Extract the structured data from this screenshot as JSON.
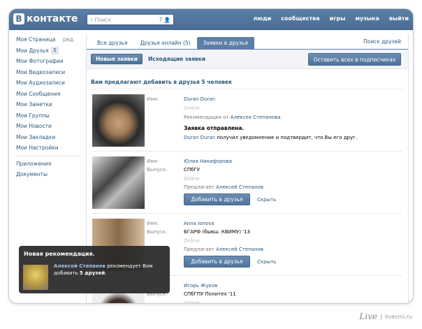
{
  "header": {
    "logo": "В",
    "logo_text": "контакте",
    "search_placeholder": "Поиск",
    "search_count": "7",
    "nav": [
      "люди",
      "сообщества",
      "игры",
      "музыка",
      "выйти"
    ]
  },
  "sidebar": {
    "items": [
      {
        "label": "Моя Страница",
        "extra": "ред."
      },
      {
        "label": "Мои Друзья",
        "badge": "5"
      },
      {
        "label": "Мои Фотографии"
      },
      {
        "label": "Мои Видеозаписи"
      },
      {
        "label": "Мои Аудиозаписи"
      },
      {
        "label": "Мои Сообщения"
      },
      {
        "label": "Мои Заметки"
      },
      {
        "label": "Мои Группы"
      },
      {
        "label": "Мои Новости"
      },
      {
        "label": "Мои Закладки"
      },
      {
        "label": "Мои Настройки"
      }
    ],
    "extra": [
      "Приложения",
      "Документы"
    ]
  },
  "tabs": [
    "Все друзья",
    "Друзья онлайн (5)",
    "Заявки в друзья"
  ],
  "find_friends": "Поиск друзей",
  "subtabs": {
    "new": "Новые заявки",
    "outgoing": "Исходящие заявки",
    "leave_all": "Оставить всех в подписчиках"
  },
  "title": "Вам предлагают добавить в друзья 5 человек",
  "labels": {
    "name": "Имя:",
    "grad": "Выпуск:",
    "online": "Online",
    "suggests": "Предлагает",
    "add": "Добавить в друзья",
    "hide": "Скрыть"
  },
  "requests": [
    {
      "name": "Duran Duran",
      "rec_prefix": "Рекомендация от",
      "rec_name": "Алексея Степанова",
      "sent": "Заявка отправлена.",
      "sent_msg": "получил уведомление и подтвердит, что Вы его друг."
    },
    {
      "name": "Юлия Никифорова",
      "grad": "СПбГУ",
      "by": "Алексей Степанов"
    },
    {
      "name": "Anna Ionova",
      "grad": "БГАРФ (бывш. КВИМУ) '13",
      "by": "Алексей Степанов"
    },
    {
      "name": "Игорь Жуков",
      "grad": "СПбГПУ Политех '11"
    }
  ],
  "toast": {
    "title": "Новая рекомендация.",
    "name": "Алексей Степанов",
    "text1": "рекомендует Вам",
    "text2": "добавить",
    "count": "5 друзей",
    "end": "."
  },
  "brand": {
    "logo": "Live",
    "site": "livesmi.ru"
  }
}
